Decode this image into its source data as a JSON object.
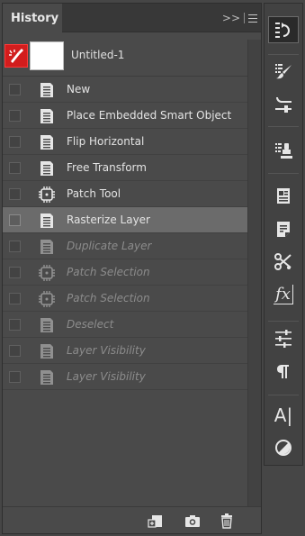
{
  "panel": {
    "tab_title": "History",
    "collapse_glyph": ">>",
    "snapshot": {
      "name": "Untitled-1"
    },
    "items": [
      {
        "label": "New",
        "icon": "document-icon",
        "state": "normal"
      },
      {
        "label": "Place Embedded Smart Object",
        "icon": "document-icon",
        "state": "normal"
      },
      {
        "label": "Flip Horizontal",
        "icon": "document-icon",
        "state": "normal"
      },
      {
        "label": "Free Transform",
        "icon": "document-icon",
        "state": "normal"
      },
      {
        "label": "Patch Tool",
        "icon": "patch-icon",
        "state": "normal"
      },
      {
        "label": "Rasterize Layer",
        "icon": "document-icon",
        "state": "selected"
      },
      {
        "label": "Duplicate Layer",
        "icon": "document-icon",
        "state": "dim"
      },
      {
        "label": "Patch Selection",
        "icon": "patch-icon",
        "state": "dim"
      },
      {
        "label": "Patch Selection",
        "icon": "patch-icon",
        "state": "dim"
      },
      {
        "label": "Deselect",
        "icon": "document-icon",
        "state": "dim"
      },
      {
        "label": "Layer Visibility",
        "icon": "document-icon",
        "state": "dim"
      },
      {
        "label": "Layer Visibility",
        "icon": "document-icon",
        "state": "dim"
      }
    ],
    "footer_icons": [
      "new-document-from-state-icon",
      "camera-icon",
      "trash-icon"
    ]
  },
  "toolbar": {
    "items": [
      "history-icon",
      "brush-presets-icon",
      "brush-settings-icon",
      "clone-source-icon",
      "properties-icon",
      "notes-icon",
      "tools-icon",
      "fx-icon",
      "adjustments-icon",
      "paragraph-icon",
      "character-icon",
      "color-icon"
    ],
    "fx_text": "fx",
    "character_text": "A|"
  },
  "colors": {
    "selected_row": "#6b6b6b",
    "active_snapshot": "#d21d1d"
  }
}
